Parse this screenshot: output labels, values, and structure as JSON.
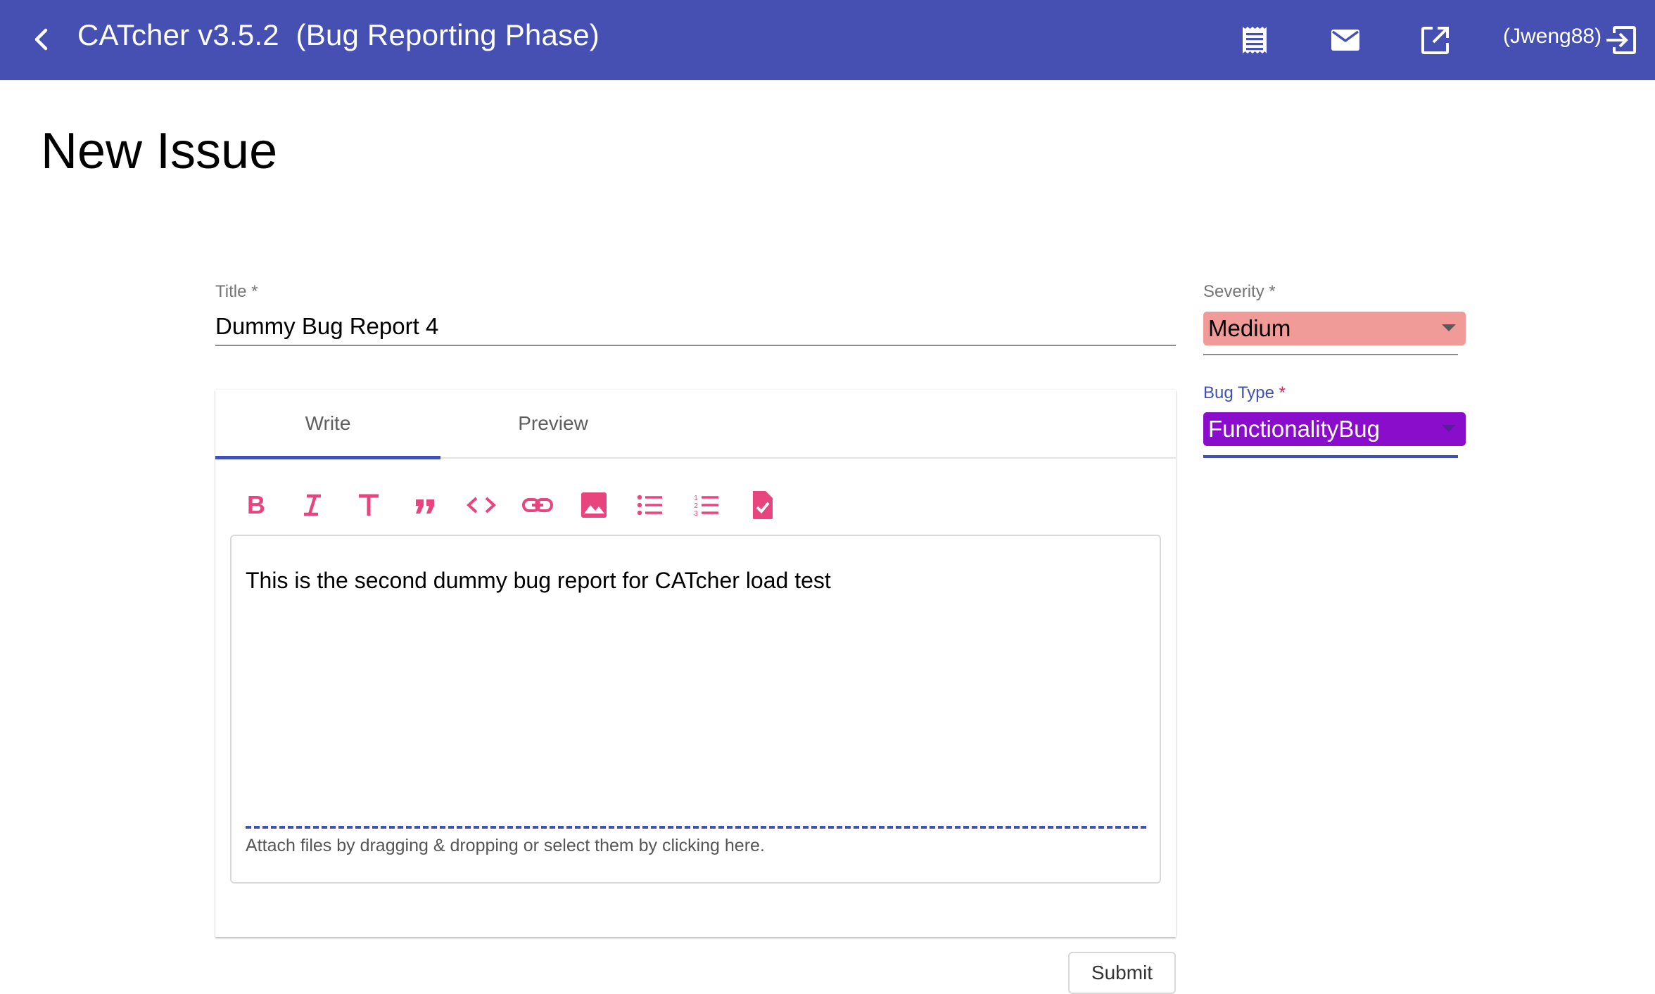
{
  "toolbar": {
    "app_title": "CATcher v3.5.2  (Bug Reporting Phase)",
    "username": "(Jweng88)",
    "back_icon": "chevron-left-icon",
    "icons": [
      "receipt-icon",
      "mail-icon",
      "open-in-new-icon",
      "logout-icon"
    ]
  },
  "page": {
    "title": "New Issue"
  },
  "form": {
    "title_label": "Title *",
    "title_value": "Dummy Bug Report 4",
    "tabs": [
      {
        "label": "Write",
        "active": true
      },
      {
        "label": "Preview",
        "active": false
      }
    ],
    "markdown_tools": [
      "bold-icon",
      "italic-icon",
      "header-icon",
      "quote-icon",
      "code-icon",
      "link-icon",
      "image-icon",
      "bulleted-list-icon",
      "numbered-list-icon",
      "task-list-icon"
    ],
    "description": "This is the second dummy bug report for CATcher load test",
    "attach_hint": "Attach files by dragging & dropping or select them by clicking here.",
    "submit_label": "Submit"
  },
  "sidebar": {
    "severity_label": "Severity *",
    "severity_value": "Medium",
    "bug_type_label": "Bug Type",
    "bug_type_required": " *",
    "bug_type_value": "FunctionalityBug"
  },
  "colors": {
    "toolbar_bg": "#4550b2",
    "accent": "#3f51b5",
    "markdown_icon": "#e8457f",
    "severity_medium_bg": "#f19b99",
    "functionality_bug_bg": "#8a0dcc",
    "required_star": "#e91e63"
  }
}
